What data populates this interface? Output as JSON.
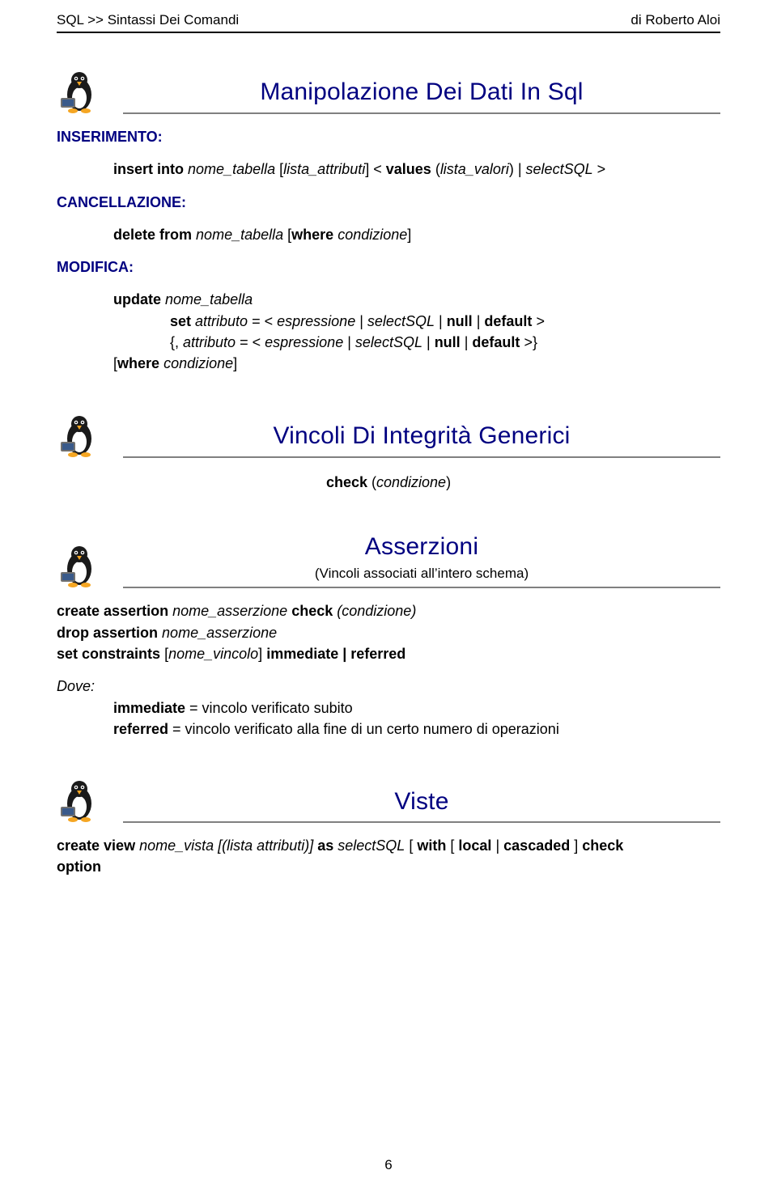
{
  "header": {
    "left": "SQL >> Sintassi Dei Comandi",
    "right": "di Roberto Aloi"
  },
  "s1": {
    "title": "Manipolazione Dei Dati In Sql",
    "ins_label": "INSERIMENTO:",
    "ins_body_a": "insert into",
    "ins_body_b": "nome_tabella",
    "ins_body_c": "[",
    "ins_body_d": "lista_attributi",
    "ins_body_e": "] <",
    "ins_body_f": "values",
    "ins_body_g": "(",
    "ins_body_h": "lista_valori",
    "ins_body_i": ") |",
    "ins_body_j": "selectSQL",
    "ins_body_k": ">",
    "canc_label": "CANCELLAZIONE:",
    "canc_a": "delete from",
    "canc_b": "nome_tabella",
    "canc_c": "[",
    "canc_d": "where",
    "canc_e": "condizione",
    "canc_f": "]",
    "mod_label": "MODIFICA:",
    "mod_l1_a": "update",
    "mod_l1_b": "nome_tabella",
    "mod_l2_a": "set",
    "mod_l2_b": "attributo",
    "mod_l2_c": "= <",
    "mod_l2_d": "espressione",
    "mod_l2_e": "|",
    "mod_l2_f": "selectSQL",
    "mod_l2_g": "|",
    "mod_l2_h": "null",
    "mod_l2_i": "|",
    "mod_l2_j": "default",
    "mod_l2_k": ">",
    "mod_l3_a": "{,",
    "mod_l3_b": "attributo",
    "mod_l3_c": "= <",
    "mod_l3_d": "espressione",
    "mod_l3_e": "|",
    "mod_l3_f": "selectSQL",
    "mod_l3_g": "|",
    "mod_l3_h": "null",
    "mod_l3_i": "|",
    "mod_l3_j": "default",
    "mod_l3_k": ">}",
    "mod_l4_a": "[",
    "mod_l4_b": "where",
    "mod_l4_c": "condizione",
    "mod_l4_d": "]"
  },
  "s2": {
    "title": "Vincoli Di Integrità Generici",
    "line_a": "check",
    "line_b": "(",
    "line_c": "condizione",
    "line_d": ")"
  },
  "s3": {
    "title": "Asserzioni",
    "subtitle": "(Vincoli associati all’intero schema)",
    "l1_a": "create assertion",
    "l1_b": "nome_asserzione",
    "l1_c": "check",
    "l1_d": "(condizione)",
    "l2_a": "drop assertion",
    "l2_b": "nome_asserzione",
    "l3_a": "set constraints",
    "l3_b": "[",
    "l3_c": "nome_vincolo",
    "l3_d": "]",
    "l3_e": "immediate | referred",
    "dove": "Dove:",
    "d1_a": "immediate",
    "d1_b": " = vincolo verificato subito",
    "d2_a": "referred",
    "d2_b": " = vincolo verificato alla fine di un certo numero di operazioni"
  },
  "s4": {
    "title": "Viste",
    "l_a": "create view",
    "l_b": "nome_vista",
    "l_c": "[(lista attributi)]",
    "l_d": "as",
    "l_e": "selectSQL",
    "l_f": "[",
    "l_g": "with",
    "l_h": "[",
    "l_i": "local",
    "l_j": "|",
    "l_k": "cascaded",
    "l_l": "]",
    "l_m": "check",
    "l2_a": "option"
  },
  "pagenum": "6"
}
